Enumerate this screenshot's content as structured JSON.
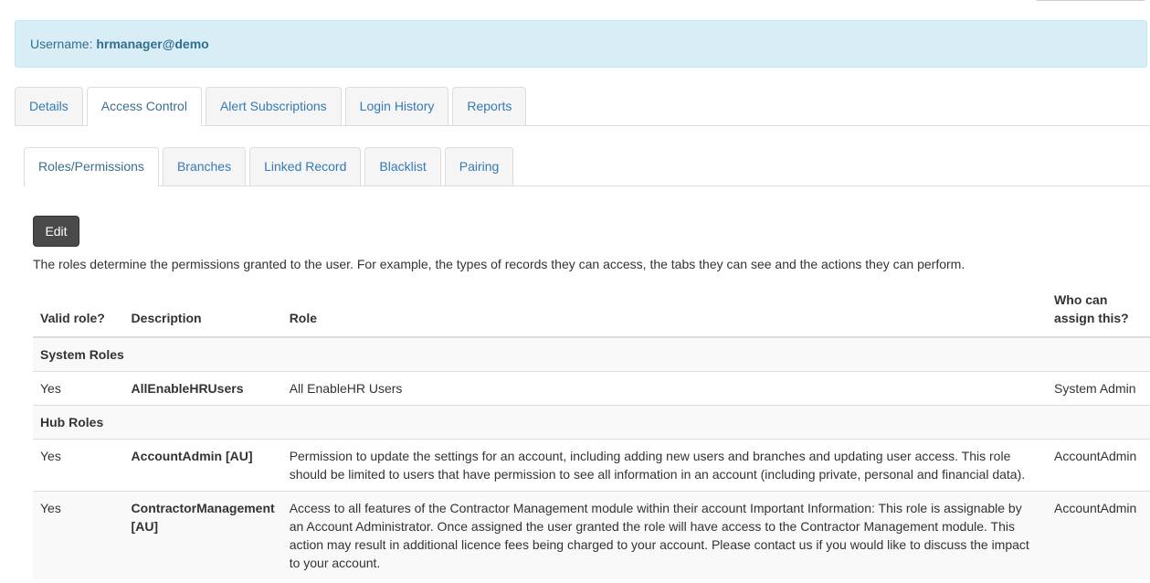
{
  "user": {
    "label": "Username:",
    "value": "hrmanager@demo"
  },
  "primary_tabs": [
    "Details",
    "Access Control",
    "Alert Subscriptions",
    "Login History",
    "Reports"
  ],
  "secondary_tabs": [
    "Roles/Permissions",
    "Branches",
    "Linked Record",
    "Blacklist",
    "Pairing"
  ],
  "edit_label": "Edit",
  "intro": "The roles determine the permissions granted to the user. For example, the types of records they can access, the tabs they can see and the actions they can perform.",
  "table": {
    "headers": {
      "valid": "Valid role?",
      "description": "Description",
      "role": "Role",
      "who_line1": "Who can",
      "who_line2": "assign this?"
    },
    "groups": [
      {
        "name": "System Roles",
        "rows": [
          {
            "valid": "Yes",
            "description": "AllEnableHRUsers",
            "role": "All EnableHR Users",
            "who": "System Admin"
          }
        ]
      },
      {
        "name": "Hub Roles",
        "rows": [
          {
            "valid": "Yes",
            "description": "AccountAdmin [AU]",
            "role": "Permission to update the settings for an account, including adding new users and branches and updating user access. This role should be limited to users that have permission to see all information in an account (including private, personal and financial data).",
            "who": "AccountAdmin"
          },
          {
            "valid": "Yes",
            "description": "ContractorManagement [AU]",
            "role": "Access to all features of the Contractor Management module within their account Important Information: This role is assignable by an Account Administrator. Once assigned the user granted the role will have access to the Contractor Management module. This action may result in additional licence fees being charged to your account. Please contact us if you would like to discuss the impact to your account.",
            "who": "AccountAdmin"
          }
        ]
      }
    ]
  }
}
